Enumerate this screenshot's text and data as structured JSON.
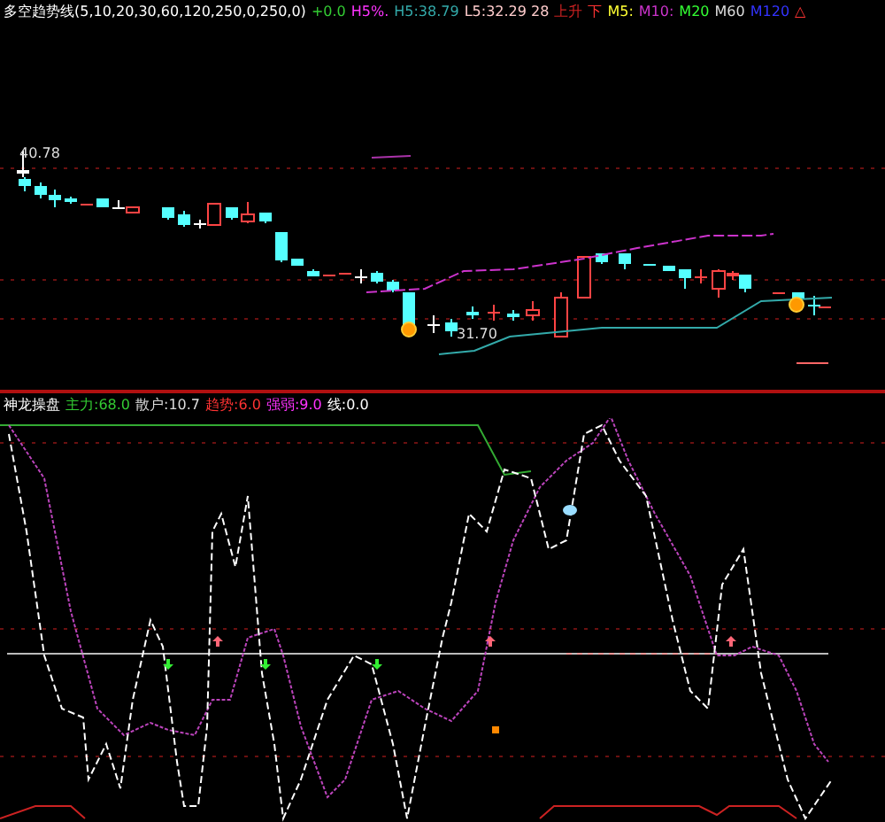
{
  "price_panel": {
    "legend": [
      {
        "text": "多空趋势线(5,10,20,30,60,120,250,0,250,0)",
        "color": "#ffffff"
      },
      {
        "text": "+0.0",
        "color": "#33cc33"
      },
      {
        "text": "H5%.",
        "color": "#ff33ff"
      },
      {
        "text": "H5:38.79",
        "color": "#33aaaa"
      },
      {
        "text": "L5:32.29 28",
        "color": "#ffcccc"
      },
      {
        "text": "上升",
        "color": "#cc2222"
      },
      {
        "text": "下",
        "color": "#ff3333"
      },
      {
        "text": "M5:",
        "color": "#ffff33"
      },
      {
        "text": "M10:",
        "color": "#cc33cc"
      },
      {
        "text": "M20",
        "color": "#33ff33"
      },
      {
        "text": "M60",
        "color": "#dddddd"
      },
      {
        "text": "M120",
        "color": "#3333ff"
      },
      {
        "text": "△",
        "color": "#ff3333"
      }
    ],
    "high_label": "40.78",
    "low_label": "31.70"
  },
  "indicator_panel": {
    "legend": [
      {
        "text": "神龙操盘",
        "color": "#ffffff"
      },
      {
        "text": "主力:68.0",
        "color": "#33cc33"
      },
      {
        "text": "散户:10.7",
        "color": "#dddddd"
      },
      {
        "text": "趋势:6.0",
        "color": "#ff3333"
      },
      {
        "text": "强弱:9.0",
        "color": "#ff33ff"
      },
      {
        "text": "线:0.0",
        "color": "#ffffff"
      }
    ]
  }
}
